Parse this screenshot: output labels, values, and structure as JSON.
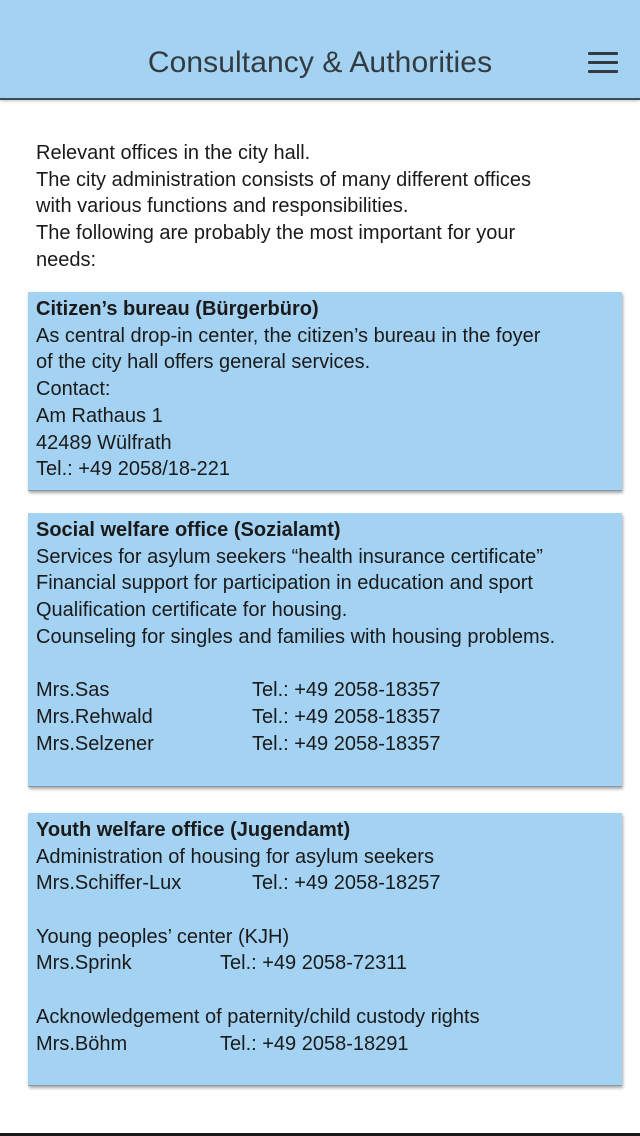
{
  "header": {
    "title": "Consultancy & Authorities"
  },
  "intro": {
    "lines": [
      "Relevant offices in the city hall.",
      "The city administration consists of many different offices",
      "with various functions and responsibilities.",
      "The following are probably the most important for your",
      "needs:"
    ]
  },
  "citizens_bureau": {
    "title": "Citizen’s bureau (Bürgerbüro)",
    "lines": [
      "As central drop-in center, the citizen’s bureau in the foyer",
      "of the city hall offers general services.",
      "Contact:",
      "Am Rathaus 1",
      "42489 Wülfrath",
      "Tel.: +49 2058/18-221"
    ]
  },
  "social_welfare": {
    "title": "Social welfare office (Sozialamt)",
    "lines": [
      "Services for asylum seekers “health insurance certificate”",
      "Financial support for participation in education and sport",
      "Qualification certificate for housing.",
      "Counseling for singles and families with housing problems."
    ],
    "contacts": [
      {
        "name": "Mrs.Sas",
        "tel": "Tel.: +49 2058-18357"
      },
      {
        "name": "Mrs.Rehwald",
        "tel": "Tel.: +49 2058-18357"
      },
      {
        "name": "Mrs.Selzener",
        "tel": "Tel.: +49 2058-18357"
      }
    ]
  },
  "youth_welfare": {
    "title": "Youth welfare office (Jugendamt)",
    "housing": {
      "label": "Administration of housing for asylum seekers",
      "name": "Mrs.Schiffer-Lux",
      "tel": "Tel.: +49 2058-18257"
    },
    "center": {
      "label": "Young peoples’ center (KJH)",
      "name": "Mrs.Sprink",
      "tel": "Tel.: +49 2058-72311"
    },
    "paternity": {
      "label": "Acknowledgement of paternity/child custody rights",
      "name": "Mrs.Böhm",
      "tel": "Tel.: +49 2058-18291"
    }
  },
  "colors": {
    "header_bg": "#a4d2f2",
    "card_bg": "#a4d2f2",
    "text": "#1a1a1a"
  }
}
